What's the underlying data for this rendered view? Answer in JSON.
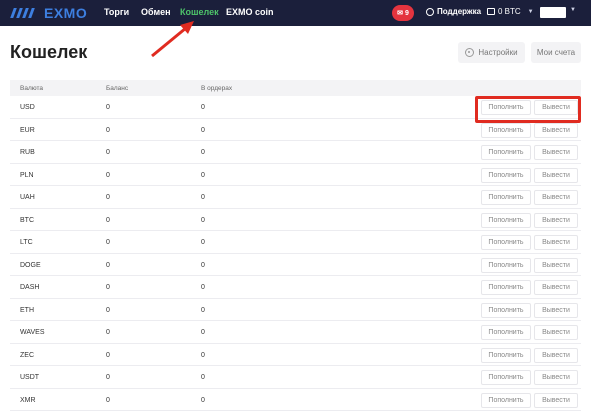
{
  "header": {
    "logo_text": "EXMO",
    "nav": [
      {
        "label": "Торги"
      },
      {
        "label": "Обмен"
      },
      {
        "label": "Кошелек",
        "active": true
      },
      {
        "label": "EXMO coin"
      }
    ],
    "notifications_count": "9",
    "support_label": "Поддержка",
    "balance_label": "0 BTC",
    "accent_color": "#3d7fe0",
    "active_color": "#4ec36a"
  },
  "page": {
    "title": "Кошелек",
    "settings_label": "Настройки",
    "accounts_label": "Мои счета"
  },
  "table": {
    "columns": [
      "Валюта",
      "Баланс",
      "В ордерах"
    ],
    "deposit_label": "Пополнить",
    "withdraw_label": "Вывести",
    "rows": [
      {
        "currency": "USD",
        "balance": "0",
        "in_orders": "0"
      },
      {
        "currency": "EUR",
        "balance": "0",
        "in_orders": "0"
      },
      {
        "currency": "RUB",
        "balance": "0",
        "in_orders": "0"
      },
      {
        "currency": "PLN",
        "balance": "0",
        "in_orders": "0"
      },
      {
        "currency": "UAH",
        "balance": "0",
        "in_orders": "0"
      },
      {
        "currency": "BTC",
        "balance": "0",
        "in_orders": "0"
      },
      {
        "currency": "LTC",
        "balance": "0",
        "in_orders": "0"
      },
      {
        "currency": "DOGE",
        "balance": "0",
        "in_orders": "0"
      },
      {
        "currency": "DASH",
        "balance": "0",
        "in_orders": "0"
      },
      {
        "currency": "ETH",
        "balance": "0",
        "in_orders": "0"
      },
      {
        "currency": "WAVES",
        "balance": "0",
        "in_orders": "0"
      },
      {
        "currency": "ZEC",
        "balance": "0",
        "in_orders": "0"
      },
      {
        "currency": "USDT",
        "balance": "0",
        "in_orders": "0"
      },
      {
        "currency": "XMR",
        "balance": "0",
        "in_orders": "0"
      }
    ]
  },
  "annotation_color": "#e02b20"
}
